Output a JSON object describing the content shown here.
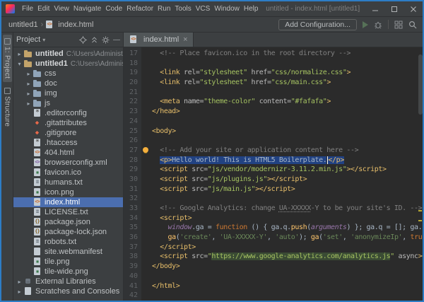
{
  "window": {
    "title": "untitled - index.html [untitled1]",
    "menu_items": [
      "File",
      "Edit",
      "View",
      "Navigate",
      "Code",
      "Refactor",
      "Run",
      "Tools",
      "VCS",
      "Window",
      "Help"
    ]
  },
  "navbar": {
    "project": "untitled1",
    "file": "index.html",
    "file_icon": "html",
    "add_configuration": "Add Configuration..."
  },
  "tool_stripe": {
    "items": [
      {
        "label": "1: Project",
        "active": true
      },
      {
        "label": "Structure",
        "active": false
      }
    ]
  },
  "project_panel": {
    "title": "Project",
    "tree": [
      {
        "label": "untitled",
        "hint": "C:\\Users\\Administrato",
        "icon": "folder-root",
        "depth": 0,
        "arrow": "collapsed",
        "bold": true
      },
      {
        "label": "untitled1",
        "hint": "C:\\Users\\Administra",
        "icon": "folder-root",
        "depth": 0,
        "arrow": "expanded",
        "bold": true
      },
      {
        "label": "css",
        "icon": "folder",
        "depth": 1,
        "arrow": "collapsed"
      },
      {
        "label": "doc",
        "icon": "folder",
        "depth": 1,
        "arrow": "collapsed"
      },
      {
        "label": "img",
        "icon": "folder",
        "depth": 1,
        "arrow": "collapsed"
      },
      {
        "label": "js",
        "icon": "folder",
        "depth": 1,
        "arrow": "collapsed"
      },
      {
        "label": ".editorconfig",
        "icon": "conf",
        "depth": 1
      },
      {
        "label": ".gitattributes",
        "icon": "git",
        "depth": 1
      },
      {
        "label": ".gitignore",
        "icon": "git",
        "depth": 1
      },
      {
        "label": ".htaccess",
        "icon": "conf",
        "depth": 1
      },
      {
        "label": "404.html",
        "icon": "html",
        "depth": 1
      },
      {
        "label": "browserconfig.xml",
        "icon": "xml",
        "depth": 1
      },
      {
        "label": "favicon.ico",
        "icon": "img",
        "depth": 1
      },
      {
        "label": "humans.txt",
        "icon": "txt",
        "depth": 1
      },
      {
        "label": "icon.png",
        "icon": "img",
        "depth": 1
      },
      {
        "label": "index.html",
        "icon": "html",
        "depth": 1,
        "selected": true
      },
      {
        "label": "LICENSE.txt",
        "icon": "txt",
        "depth": 1
      },
      {
        "label": "package.json",
        "icon": "json",
        "depth": 1
      },
      {
        "label": "package-lock.json",
        "icon": "json",
        "depth": 1
      },
      {
        "label": "robots.txt",
        "icon": "txt",
        "depth": 1
      },
      {
        "label": "site.webmanifest",
        "icon": "file",
        "depth": 1
      },
      {
        "label": "tile.png",
        "icon": "img",
        "depth": 1
      },
      {
        "label": "tile-wide.png",
        "icon": "img",
        "depth": 1
      },
      {
        "label": "External Libraries",
        "icon": "lib",
        "depth": 0,
        "arrow": "collapsed"
      },
      {
        "label": "Scratches and Consoles",
        "icon": "scratch",
        "depth": 0,
        "arrow": "collapsed"
      }
    ]
  },
  "editor": {
    "tab_label": "index.html",
    "tab_icon": "html",
    "lines": [
      {
        "n": 17,
        "s": [
          [
            "  ",
            "pl"
          ],
          [
            "<!-- Place favicon.ico in the root directory -->",
            "cm"
          ]
        ]
      },
      {
        "n": 18,
        "s": []
      },
      {
        "n": 19,
        "s": [
          [
            "  ",
            "pl"
          ],
          [
            "<link ",
            "tg"
          ],
          [
            "rel=",
            "at"
          ],
          [
            "\"stylesheet\" ",
            "av"
          ],
          [
            "href=",
            "at"
          ],
          [
            "\"css/normalize.css\"",
            "av"
          ],
          [
            ">",
            "tg"
          ]
        ]
      },
      {
        "n": 20,
        "s": [
          [
            "  ",
            "pl"
          ],
          [
            "<link ",
            "tg"
          ],
          [
            "rel=",
            "at"
          ],
          [
            "\"stylesheet\" ",
            "av"
          ],
          [
            "href=",
            "at"
          ],
          [
            "\"css/main.css\"",
            "av"
          ],
          [
            ">",
            "tg"
          ]
        ]
      },
      {
        "n": 21,
        "s": []
      },
      {
        "n": 22,
        "s": [
          [
            "  ",
            "pl"
          ],
          [
            "<meta ",
            "tg"
          ],
          [
            "name=",
            "at"
          ],
          [
            "\"theme-color\" ",
            "av"
          ],
          [
            "content=",
            "at"
          ],
          [
            "\"#fafafa\"",
            "av"
          ],
          [
            ">",
            "tg"
          ]
        ]
      },
      {
        "n": 23,
        "s": [
          [
            "</head>",
            "tg"
          ]
        ]
      },
      {
        "n": 24,
        "s": []
      },
      {
        "n": 25,
        "s": [
          [
            "<body>",
            "tg"
          ]
        ]
      },
      {
        "n": 26,
        "s": []
      },
      {
        "n": 27,
        "bulb": true,
        "s": [
          [
            "  ",
            "pl"
          ],
          [
            "<!-- Add your site or application content here -->",
            "cm"
          ]
        ]
      },
      {
        "n": 28,
        "s": [
          [
            "  ",
            "pl"
          ],
          [
            "<p>",
            "tg hl"
          ],
          [
            "Hello world! This is HTML5 Boilerplate.",
            "txt hl"
          ],
          [
            "",
            "caret"
          ],
          [
            "</p>",
            "tg hl"
          ]
        ]
      },
      {
        "n": 29,
        "s": [
          [
            "  ",
            "pl"
          ],
          [
            "<script ",
            "tg"
          ],
          [
            "src=",
            "at"
          ],
          [
            "\"js/vendor/modernizr-3.11.2.min.js\"",
            "av"
          ],
          [
            "></script>",
            "tg"
          ]
        ]
      },
      {
        "n": 30,
        "s": [
          [
            "  ",
            "pl"
          ],
          [
            "<script ",
            "tg"
          ],
          [
            "src=",
            "at"
          ],
          [
            "\"js/plugins.js\"",
            "av"
          ],
          [
            "></script>",
            "tg"
          ]
        ]
      },
      {
        "n": 31,
        "s": [
          [
            "  ",
            "pl"
          ],
          [
            "<script ",
            "tg"
          ],
          [
            "src=",
            "at"
          ],
          [
            "\"js/main.js\"",
            "av"
          ],
          [
            "></script>",
            "tg"
          ]
        ]
      },
      {
        "n": 32,
        "s": []
      },
      {
        "n": 33,
        "s": [
          [
            "  ",
            "pl"
          ],
          [
            "<!-- Google Analytics: change ",
            "cm"
          ],
          [
            "UA-XXXXX",
            "cm wavy"
          ],
          [
            "-Y to be your site's ID. -->",
            "cm"
          ]
        ]
      },
      {
        "n": 34,
        "s": [
          [
            "  ",
            "pl"
          ],
          [
            "<script>",
            "tg"
          ]
        ]
      },
      {
        "n": 35,
        "s": [
          [
            "    ",
            "pl"
          ],
          [
            "window",
            "gv"
          ],
          [
            ".ga = ",
            "pl"
          ],
          [
            "function",
            "kw"
          ],
          [
            " () { ga.q.",
            "pl"
          ],
          [
            "push",
            "fn"
          ],
          [
            "(",
            "pl"
          ],
          [
            "arguments",
            "gv"
          ],
          [
            ") }; ga.q = []; ga.l = +new Date;",
            "pl"
          ]
        ]
      },
      {
        "n": 36,
        "s": [
          [
            "    ",
            "pl"
          ],
          [
            "ga",
            "fn"
          ],
          [
            "(",
            "pl"
          ],
          [
            "'create'",
            "st"
          ],
          [
            ", ",
            "pl"
          ],
          [
            "'UA-XXXXX-Y'",
            "st"
          ],
          [
            ", ",
            "pl"
          ],
          [
            "'auto'",
            "st"
          ],
          [
            "); ",
            "pl"
          ],
          [
            "ga",
            "fn"
          ],
          [
            "(",
            "pl"
          ],
          [
            "'set'",
            "st"
          ],
          [
            ", ",
            "pl"
          ],
          [
            "'anonymizeIp'",
            "st"
          ],
          [
            ", ",
            "pl"
          ],
          [
            "true",
            "kw"
          ],
          [
            ");",
            "pl"
          ]
        ]
      },
      {
        "n": 37,
        "s": [
          [
            "  ",
            "pl"
          ],
          [
            "</script>",
            "tg"
          ]
        ]
      },
      {
        "n": 38,
        "s": [
          [
            "  ",
            "pl"
          ],
          [
            "<script ",
            "tg"
          ],
          [
            "src=",
            "at"
          ],
          [
            "\"",
            "av"
          ],
          [
            "https://www.google-analytics.com/analytics.js",
            "av urlbox"
          ],
          [
            "\" ",
            "av"
          ],
          [
            "async",
            "at"
          ],
          [
            "></script>",
            "tg"
          ]
        ]
      },
      {
        "n": 39,
        "s": [
          [
            "</body>",
            "tg"
          ]
        ]
      },
      {
        "n": 40,
        "s": []
      },
      {
        "n": 41,
        "s": [
          [
            "</html>",
            "tg"
          ]
        ]
      },
      {
        "n": 42,
        "s": []
      }
    ]
  },
  "glyphs": {
    "chevron_down": "▾",
    "breadcrumb_separator": "›",
    "tree_collapsed": "▸",
    "tree_expanded": "▾",
    "close": "×",
    "hide": "—"
  },
  "icon_glyphs": {
    "html": "<>",
    "xml": "<>",
    "json": "{}",
    "txt": "≡",
    "conf": "*",
    "git": "◆",
    "lib": "▤",
    "img": "▪",
    "file": "",
    "scratch": "",
    "folder": "",
    "folder-root": ""
  },
  "colors": {
    "window_border": "#2d7dc6",
    "panel_bg": "#3c3f41",
    "editor_bg": "#2b2b2b",
    "tree_selection": "#4b6eaf",
    "text_selection": "#214283",
    "tag": "#e8bf6a",
    "attr_value": "#a5c261",
    "js_string": "#6a8759",
    "keyword": "#cc7832",
    "comment": "#808080"
  }
}
